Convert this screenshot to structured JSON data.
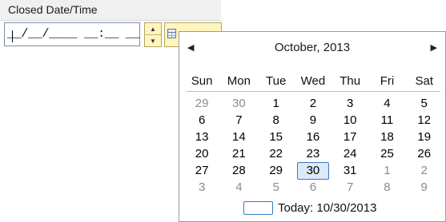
{
  "field": {
    "label": "Closed Date/Time",
    "mask": "__/__/____ __:__ __"
  },
  "spinner": {
    "up_icon": "triangle-up",
    "down_icon": "triangle-down"
  },
  "calendar_button": {
    "icon": "calendar-icon"
  },
  "calendar": {
    "month_title": "October, 2013",
    "prev_glyph": "◀",
    "next_glyph": "▶",
    "weekdays": [
      "Sun",
      "Mon",
      "Tue",
      "Wed",
      "Thu",
      "Fri",
      "Sat"
    ],
    "weeks": [
      [
        "29",
        "30",
        "1",
        "2",
        "3",
        "4",
        "5"
      ],
      [
        "6",
        "7",
        "8",
        "9",
        "10",
        "11",
        "12"
      ],
      [
        "13",
        "14",
        "15",
        "16",
        "17",
        "18",
        "19"
      ],
      [
        "20",
        "21",
        "22",
        "23",
        "24",
        "25",
        "26"
      ],
      [
        "27",
        "28",
        "29",
        "30",
        "31",
        "1",
        "2"
      ],
      [
        "3",
        "4",
        "5",
        "6",
        "7",
        "8",
        "9"
      ]
    ],
    "today_label": "Today: 10/30/2013"
  },
  "colors": {
    "today_border": "#3c79c2",
    "muted_day": "#8c8c8c",
    "button_bg": "#fff6bf"
  }
}
